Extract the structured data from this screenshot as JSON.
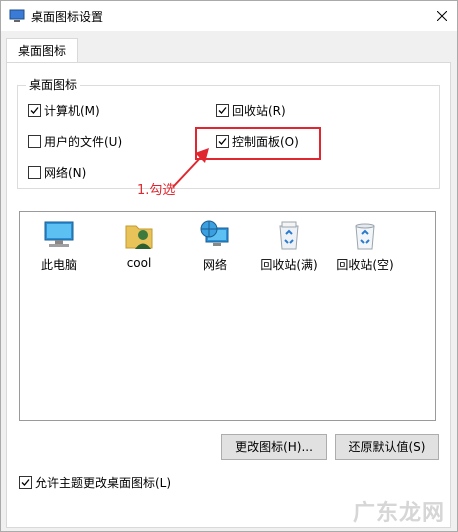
{
  "window": {
    "title": "桌面图标设置"
  },
  "tabs": [
    {
      "label": "桌面图标"
    }
  ],
  "group": {
    "title": "桌面图标",
    "checkboxes": [
      {
        "label": "计算机(M)",
        "checked": true
      },
      {
        "label": "回收站(R)",
        "checked": true
      },
      {
        "label": "用户的文件(U)",
        "checked": false
      },
      {
        "label": "控制面板(O)",
        "checked": true
      },
      {
        "label": "网络(N)",
        "checked": false
      }
    ]
  },
  "annotation": {
    "text": "1.勾选",
    "color": "#e0272f"
  },
  "icons": [
    {
      "label": "此电脑",
      "icon": "computer-icon"
    },
    {
      "label": "cool",
      "icon": "user-folder-icon"
    },
    {
      "label": "网络",
      "icon": "network-icon"
    },
    {
      "label": "回收站(满)",
      "icon": "recycle-bin-full-icon"
    },
    {
      "label": "回收站(空)",
      "icon": "recycle-bin-empty-icon"
    }
  ],
  "buttons": {
    "change_icon": "更改图标(H)...",
    "restore_default": "还原默认值(S)"
  },
  "allow_theme": {
    "label": "允许主题更改桌面图标(L)",
    "checked": true
  },
  "watermark": "广东龙网"
}
